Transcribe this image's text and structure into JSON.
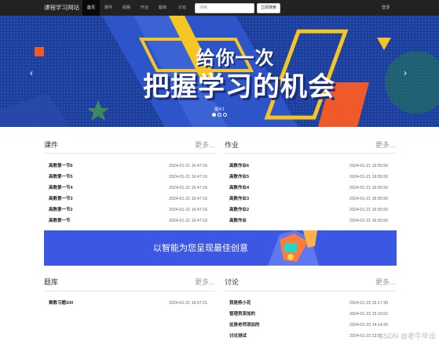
{
  "navbar": {
    "brand": "课程学习网站",
    "items": [
      "首页",
      "课件",
      "视频",
      "作业",
      "题库",
      "讨论"
    ],
    "search_placeholder": "搜索",
    "search_button": "立即搜索",
    "login": "登录"
  },
  "banner": {
    "line1": "给你一次",
    "line2": "把握学习的机会",
    "caption": "图片1",
    "prev": "‹",
    "next": "›"
  },
  "courseware": {
    "title": "课件",
    "more": "更多...",
    "rows": [
      {
        "title": "高数第一节6",
        "date": "2024-01-21 16:47:16"
      },
      {
        "title": "高数第一节5",
        "date": "2024-01-21 16:47:16"
      },
      {
        "title": "高数第一节4",
        "date": "2024-01-21 16:47:16"
      },
      {
        "title": "高数第一节3",
        "date": "2024-01-21 16:47:16"
      },
      {
        "title": "高数第一节2",
        "date": "2024-01-21 16:47:16"
      },
      {
        "title": "高数第一节",
        "date": "2024-01-21 16:47:16"
      }
    ]
  },
  "homework": {
    "title": "作业",
    "more": "更多...",
    "rows": [
      {
        "title": "高数作业6",
        "date": "2024-01-21 16:55:50"
      },
      {
        "title": "高数作业5",
        "date": "2024-01-21 16:55:50"
      },
      {
        "title": "高数作业4",
        "date": "2024-01-21 16:55:50"
      },
      {
        "title": "高数作业3",
        "date": "2024-01-21 16:55:50"
      },
      {
        "title": "高数作业2",
        "date": "2024-01-21 16:55:50"
      },
      {
        "title": "高数作业",
        "date": "2024-01-21 16:55:50"
      }
    ]
  },
  "ad": {
    "text": "以智能为您呈现最佳创意"
  },
  "question_bank": {
    "title": "题库",
    "more": "更多...",
    "rows": [
      {
        "title": "乘数习题100",
        "date": "2024-01-21 16:57:21"
      }
    ]
  },
  "discussion": {
    "title": "讨论",
    "more": "更多...",
    "rows": [
      {
        "title": "我是杨小花",
        "date": "2024-01-23 15:17:39"
      },
      {
        "title": "管理员添加的",
        "date": "2024-01-23 15:15:01"
      },
      {
        "title": "这是老师添加的",
        "date": "2024-01-23 14:14:20"
      },
      {
        "title": "讨论测试",
        "date": "2024-01-23 13:55:"
      }
    ]
  },
  "watermark": "CSDN @老牛毕设",
  "colors": {
    "navbar": "#222222",
    "banner_blue": "#1d3f9c",
    "accent_yellow": "#f5c623",
    "accent_orange": "#f0592a",
    "ad_blue": "#3d57e5"
  }
}
